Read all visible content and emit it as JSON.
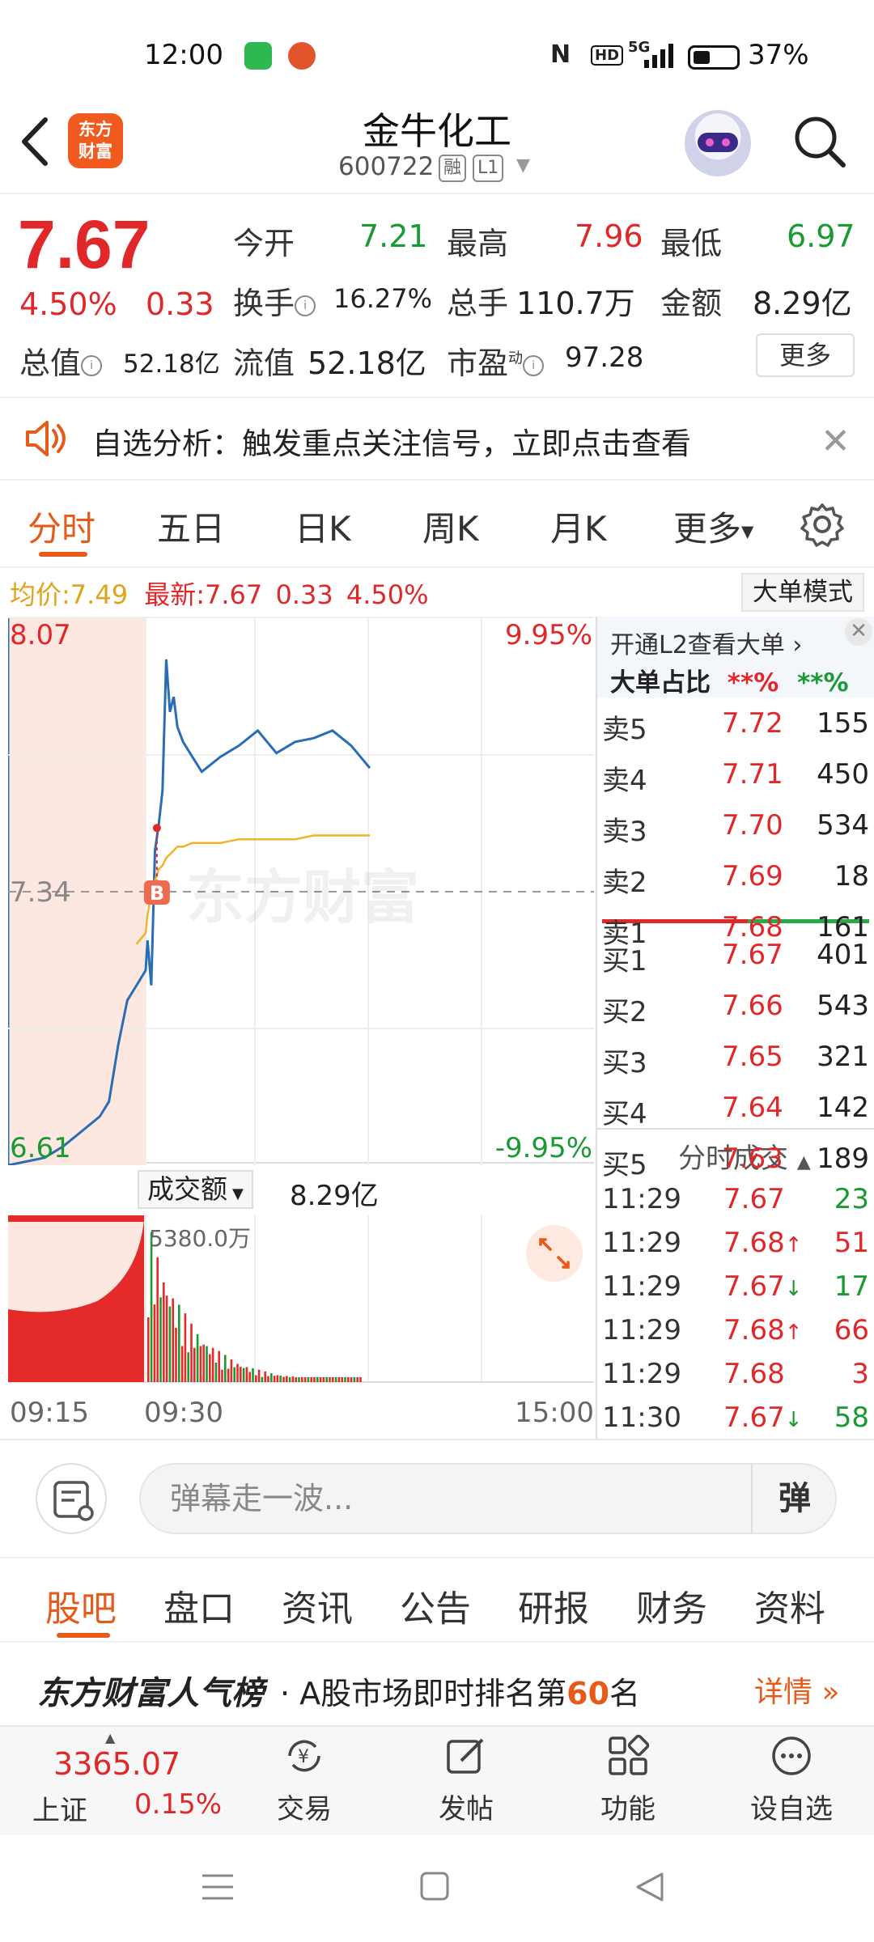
{
  "status_bar": {
    "time": "12:00",
    "battery": "37%",
    "network": "5G"
  },
  "header": {
    "stock_name": "金牛化工",
    "stock_code": "600722",
    "tag_margin": "融",
    "tag_level": "L1",
    "logo_line1": "东方",
    "logo_line2": "财富"
  },
  "quote": {
    "price": "7.67",
    "change_pct": "4.50%",
    "change": "0.33",
    "open_label": "今开",
    "open": "7.21",
    "high_label": "最高",
    "high": "7.96",
    "low_label": "最低",
    "low": "6.97",
    "turnover_label": "换手",
    "turnover": "16.27%",
    "volume_label": "总手",
    "volume": "110.7万",
    "amount_label": "金额",
    "amount": "8.29亿",
    "mktcap_label": "总值",
    "mktcap": "52.18亿",
    "float_label": "流值",
    "float": "52.18亿",
    "pe_label": "市盈",
    "pe_super": "动",
    "pe": "97.28",
    "more": "更多"
  },
  "alert": {
    "text": "自选分析：触发重点关注信号，立即点击查看"
  },
  "period_tabs": [
    "分时",
    "五日",
    "日K",
    "周K",
    "月K",
    "更多"
  ],
  "legend": {
    "avg_label": "均价:",
    "avg": "7.49",
    "last_label": "最新:",
    "last": "7.67",
    "chg": "0.33",
    "pct": "4.50%",
    "big_mode": "大单模式"
  },
  "chart_labels": {
    "y_max": "8.07",
    "y_mid": "7.34",
    "y_min": "6.61",
    "pct_max": "9.95%",
    "pct_min": "-9.95%",
    "marker": "B",
    "watermark": "东方财富"
  },
  "chart_data": {
    "type": "line",
    "x": [
      "09:15",
      "09:17",
      "09:19",
      "09:21",
      "09:23",
      "09:25",
      "09:26",
      "09:27",
      "09:28",
      "09:29",
      "09:30",
      "09:31",
      "09:33",
      "09:35",
      "09:37",
      "09:39",
      "09:41",
      "09:43",
      "09:45",
      "09:47",
      "09:50",
      "09:55",
      "10:00",
      "10:10",
      "10:20",
      "10:30",
      "10:40",
      "10:50",
      "11:00",
      "11:10",
      "11:20",
      "11:30"
    ],
    "series": [
      {
        "values": [
          6.61,
          6.62,
          6.63,
          6.66,
          6.7,
          6.74,
          6.78,
          6.93,
          7.05,
          7.09,
          7.13,
          7.21,
          7.09,
          7.45,
          7.52,
          7.61,
          7.96,
          7.82,
          7.86,
          7.78,
          7.74,
          7.7,
          7.66,
          7.7,
          7.73,
          7.77,
          7.71,
          7.74,
          7.75,
          7.77,
          7.73,
          7.67
        ]
      },
      {
        "values": [
          null,
          null,
          null,
          null,
          null,
          null,
          null,
          null,
          null,
          7.2,
          7.23,
          7.28,
          7.33,
          7.37,
          7.4,
          7.41,
          7.43,
          7.44,
          7.45,
          7.46,
          7.46,
          7.47,
          7.47,
          7.47,
          7.48,
          7.48,
          7.48,
          7.48,
          7.49,
          7.49,
          7.49,
          7.49
        ]
      }
    ],
    "ylim": [
      6.61,
      8.07
    ],
    "x_range": [
      "09:15",
      "15:00"
    ],
    "volume_max_label": "5380.0万"
  },
  "volume": {
    "label": "成交额",
    "total": "8.29亿",
    "max_label": "5380.0万"
  },
  "time_axis": [
    "09:15",
    "09:30",
    "15:00"
  ],
  "order_book": {
    "header": "开通L2查看大单",
    "ratio_label": "大单占比",
    "ratio_buy": "**%",
    "ratio_sell": "**%",
    "asks": [
      {
        "label": "卖5",
        "price": "7.72",
        "vol": "155"
      },
      {
        "label": "卖4",
        "price": "7.71",
        "vol": "450"
      },
      {
        "label": "卖3",
        "price": "7.70",
        "vol": "534"
      },
      {
        "label": "卖2",
        "price": "7.69",
        "vol": "18"
      },
      {
        "label": "卖1",
        "price": "7.68",
        "vol": "161"
      }
    ],
    "bids": [
      {
        "label": "买1",
        "price": "7.67",
        "vol": "401"
      },
      {
        "label": "买2",
        "price": "7.66",
        "vol": "543"
      },
      {
        "label": "买3",
        "price": "7.65",
        "vol": "321"
      },
      {
        "label": "买4",
        "price": "7.64",
        "vol": "142"
      },
      {
        "label": "买5",
        "price": "7.63",
        "vol": "189"
      }
    ],
    "trades_header": "分时成交",
    "trades": [
      {
        "time": "11:29",
        "price": "7.67",
        "dir": "",
        "vol": "23",
        "color": "#1a9a32"
      },
      {
        "time": "11:29",
        "price": "7.68",
        "dir": "↑",
        "vol": "51",
        "color": "#e0282b"
      },
      {
        "time": "11:29",
        "price": "7.67",
        "dir": "↓",
        "vol": "17",
        "color": "#1a9a32"
      },
      {
        "time": "11:29",
        "price": "7.68",
        "dir": "↑",
        "vol": "66",
        "color": "#e0282b"
      },
      {
        "time": "11:29",
        "price": "7.68",
        "dir": "",
        "vol": "3",
        "color": "#e0282b"
      },
      {
        "time": "11:30",
        "price": "7.67",
        "dir": "↓",
        "vol": "58",
        "color": "#1a9a32"
      }
    ]
  },
  "danmaku": {
    "placeholder": "弹幕走一波...",
    "send": "弹"
  },
  "bottom_tabs": [
    "股吧",
    "盘口",
    "资讯",
    "公告",
    "研报",
    "财务",
    "资料"
  ],
  "rank": {
    "brand": "东方财富人气榜",
    "prefix": "· A股市场即时排名第",
    "num": "60",
    "suffix": "名",
    "more": "详情"
  },
  "bottom_nav": {
    "index_value": "3365.07",
    "index_name": "上证",
    "index_pct": "0.15%",
    "items": [
      {
        "label": "交易",
        "icon": "trade-icon"
      },
      {
        "label": "发帖",
        "icon": "post-icon"
      },
      {
        "label": "功能",
        "icon": "apps-icon"
      },
      {
        "label": "设自选",
        "icon": "add-watchlist-icon"
      }
    ]
  },
  "colors": {
    "up": "#e0282b",
    "down": "#1a9a32",
    "accent": "#e65a1a",
    "price_line": "#2a6db5",
    "avg_line": "#f0b428"
  }
}
